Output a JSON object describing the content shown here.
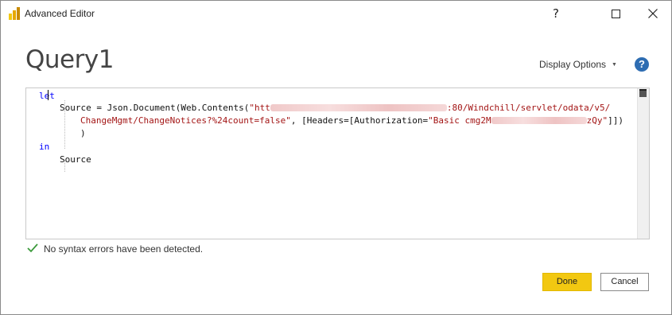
{
  "window": {
    "title": "Advanced Editor",
    "help_glyph": "?",
    "maximize_icon": "maximize-icon",
    "close_icon": "close-icon"
  },
  "header": {
    "query_name": "Query1",
    "display_options_label": "Display Options",
    "help_label": "?"
  },
  "editor": {
    "kw_let": "let",
    "kw_in": "in",
    "source_prefix": "Source = Json.Document(Web.Contents(",
    "url_start": "\"htt",
    "url_end": ":80/Windchill/servlet/odata/v5/",
    "url_continuation": "ChangeMgmt/ChangeNotices?%24count=false\"",
    "headers_part": ", [Headers=[Authorization=",
    "auth_start": "\"Basic cmg2M",
    "auth_end": "zQy\"",
    "line2_end": "]])",
    "line3": ")",
    "source_output": "Source"
  },
  "status": {
    "message": "No syntax errors have been detected.",
    "color": "#3c9a3c"
  },
  "buttons": {
    "done": "Done",
    "cancel": "Cancel"
  },
  "colors": {
    "accent": "#f2c811",
    "keyword": "#0000ff",
    "string": "#a31515",
    "help": "#2e6db2"
  }
}
